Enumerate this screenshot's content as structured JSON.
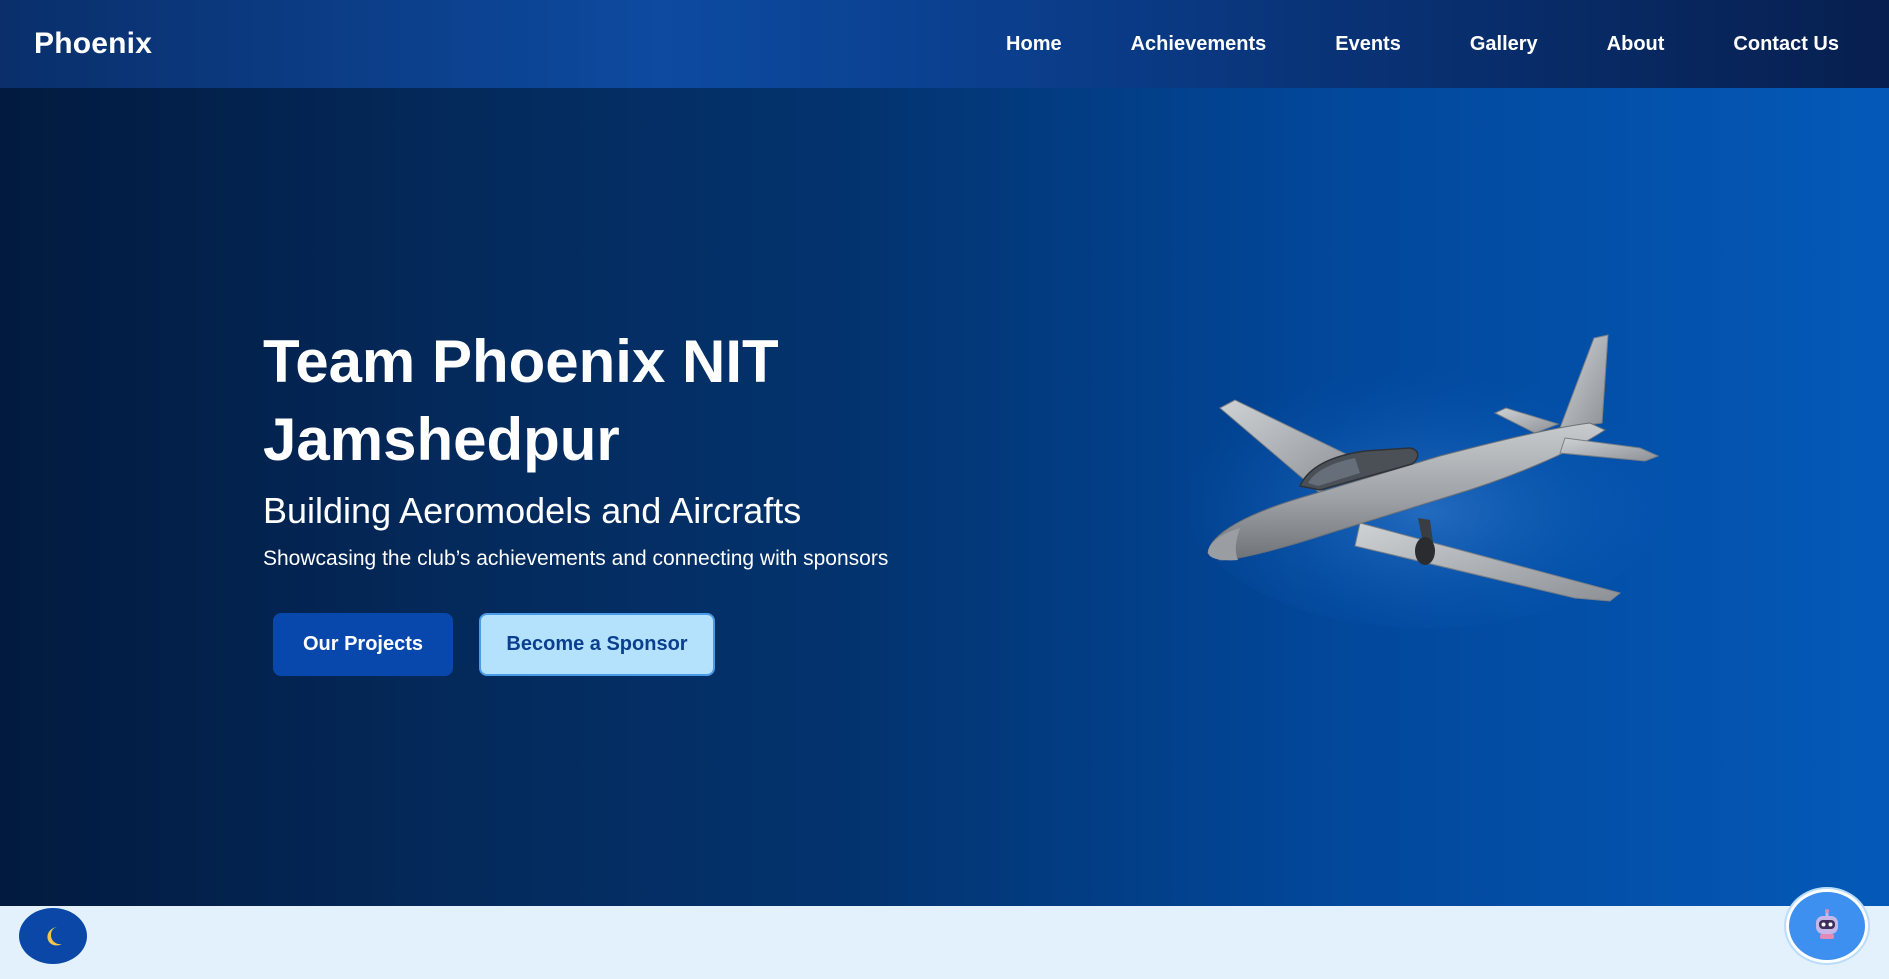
{
  "brand": {
    "name": "Phoenix"
  },
  "nav": {
    "items": [
      {
        "label": "Home"
      },
      {
        "label": "Achievements"
      },
      {
        "label": "Events"
      },
      {
        "label": "Gallery"
      },
      {
        "label": "About"
      },
      {
        "label": "Contact Us"
      }
    ]
  },
  "hero": {
    "title_line1": "Team Phoenix NIT",
    "title_line2": "Jamshedpur",
    "subtitle": "Building Aeromodels and Aircrafts",
    "tagline": "Showcasing the club’s achievements and connecting with sponsors",
    "primary_button": "Our Projects",
    "secondary_button": "Become a Sponsor",
    "image_icon": "aircraft-model-icon"
  },
  "floating": {
    "theme_toggle_icon": "moon-icon",
    "chatbot_icon": "robot-icon"
  },
  "colors": {
    "nav_bg": "#0a3a85",
    "hero_dark": "#021a3f",
    "hero_light": "#0459b8",
    "primary_button": "#0848ad",
    "secondary_button": "#b4e2fc",
    "page_bg": "#e3f1fd"
  }
}
